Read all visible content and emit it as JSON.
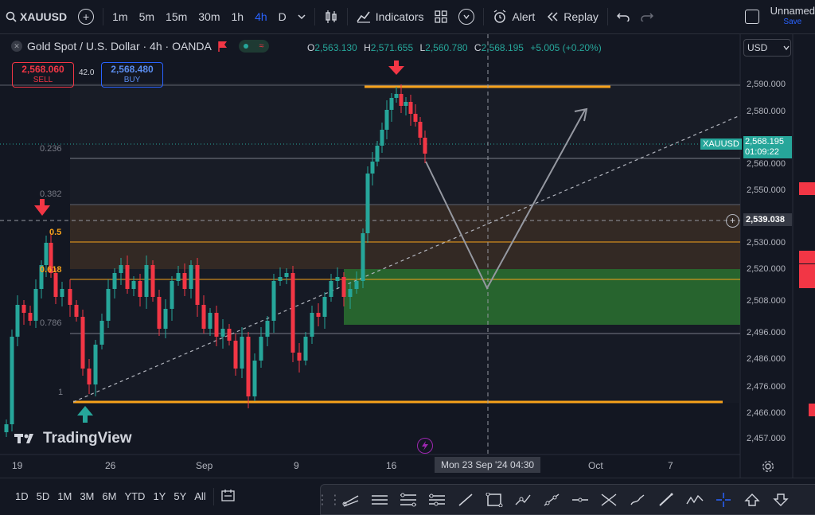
{
  "topbar": {
    "symbol": "XAUUSD",
    "intervals": [
      "1m",
      "5m",
      "15m",
      "30m",
      "1h",
      "4h",
      "D"
    ],
    "active_interval": "4h",
    "indicators_label": "Indicators",
    "alert_label": "Alert",
    "replay_label": "Replay",
    "layout_name": "Unnamed",
    "save_label": "Save"
  },
  "legend": {
    "title": "Gold Spot / U.S. Dollar · 4h · OANDA",
    "o_label": "O",
    "o_value": "2,563.130",
    "h_label": "H",
    "h_value": "2,571.655",
    "l_label": "L",
    "l_value": "2,560.780",
    "c_label": "C",
    "c_value": "2,568.195",
    "change": "+5.005 (+0.20%)"
  },
  "trade": {
    "sell_price": "2,568.060",
    "sell_label": "SELL",
    "spread": "42.0",
    "buy_price": "2,568.480",
    "buy_label": "BUY"
  },
  "currency": "USD",
  "price_axis": [
    "2,590.000",
    "2,580.000",
    "2,560.000",
    "2,550.000",
    "2,530.000",
    "2,520.000",
    "2,508.000",
    "2,496.000",
    "2,486.000",
    "2,476.000",
    "2,466.000",
    "2,457.000"
  ],
  "last_price_tag": {
    "symbol": "XAUUSD",
    "price": "2,568.195",
    "countdown": "01:09:22"
  },
  "crosshair_price": "2,539.038",
  "crosshair_date": "Mon 23 Sep '24   04:30",
  "fib_levels": [
    "0.236",
    "0.382",
    "0.5",
    "0.618",
    "0.786",
    "1"
  ],
  "time_axis": [
    "19",
    "26",
    "Sep",
    "9",
    "16",
    "Oct",
    "7"
  ],
  "watermark": "TradingView",
  "bottombar": {
    "ranges": [
      "1D",
      "5D",
      "1M",
      "3M",
      "6M",
      "YTD",
      "1Y",
      "5Y",
      "All"
    ]
  },
  "colors": {
    "bg": "#131722",
    "up": "#26a69a",
    "down": "#f23645",
    "accent": "#2962ff",
    "orange": "#f7a21b",
    "green_zone": "#2e7d32",
    "brown_zone": "#3d2e26"
  },
  "chart_data": {
    "type": "candlestick",
    "title": "Gold Spot / U.S. Dollar · 4h · OANDA",
    "ylim": [
      2457,
      2597
    ],
    "horizontal_levels": [
      2590,
      2546,
      2530,
      2515,
      2494,
      2470
    ]
  }
}
